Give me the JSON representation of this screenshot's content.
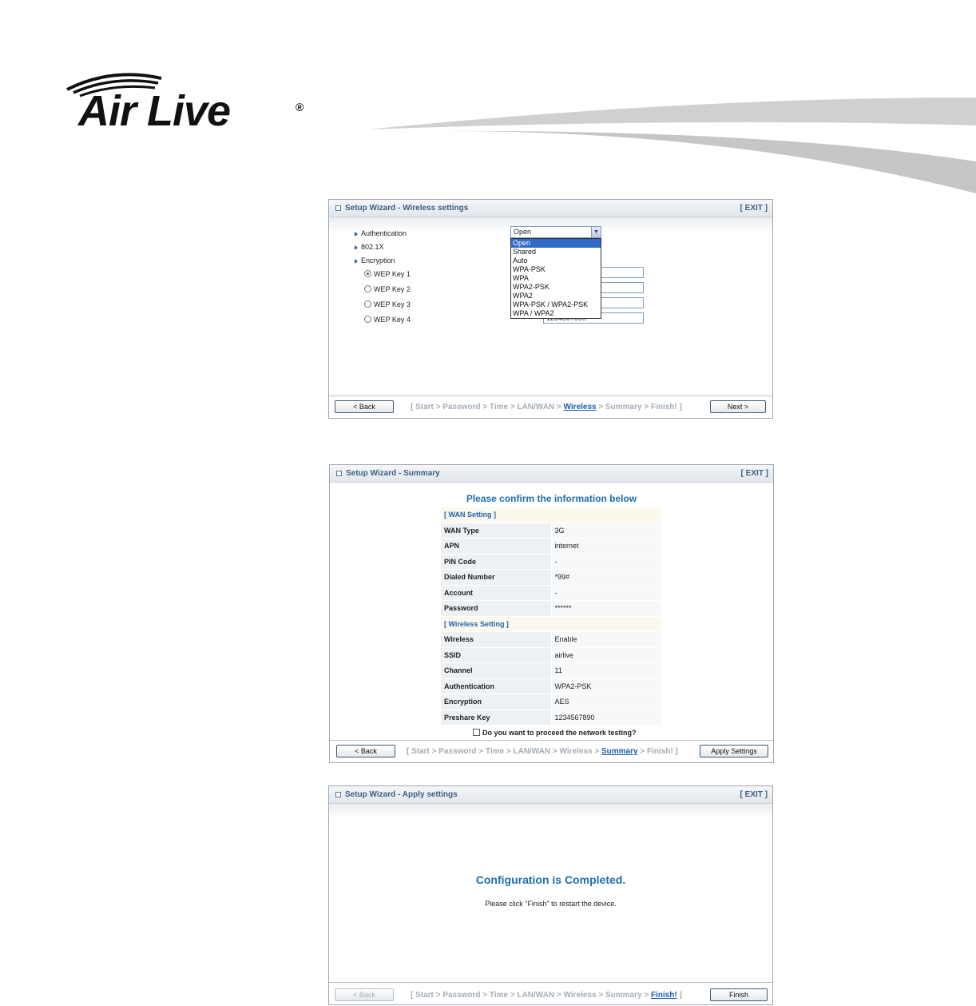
{
  "logo": {
    "text": "Air Live",
    "reg": "®"
  },
  "wireless_panel": {
    "title": "Setup Wizard - Wireless settings",
    "exit": "[ EXIT ]",
    "rows": {
      "authentication": "Authentication",
      "dot1x": "802.1X",
      "encryption": "Encryption",
      "wep1": "WEP Key 1",
      "wep2": "WEP Key 2",
      "wep3": "WEP Key 3",
      "wep4": "WEP Key 4"
    },
    "auth_selected": "Open",
    "auth_options": [
      "Open",
      "Shared",
      "Auto",
      "WPA-PSK",
      "WPA",
      "WPA2-PSK",
      "WPA2",
      "WPA-PSK / WPA2-PSK",
      "WPA / WPA2"
    ],
    "wep4_partial_value": "1234567890",
    "back": "< Back",
    "next": "Next >",
    "crumbs": {
      "pre": "[ Start > Password > Time > LAN/WAN > ",
      "cur": "Wireless",
      "post": " > Summary > Finish! ]"
    }
  },
  "summary_panel": {
    "title": "Setup Wizard - Summary",
    "exit": "[ EXIT ]",
    "heading": "Please confirm the information below",
    "wan_section": "[ WAN Setting ]",
    "wan_rows": [
      {
        "k": "WAN Type",
        "v": "3G"
      },
      {
        "k": "APN",
        "v": "internet"
      },
      {
        "k": "PIN Code",
        "v": "-"
      },
      {
        "k": "Dialed Number",
        "v": "*99#"
      },
      {
        "k": "Account",
        "v": "-"
      },
      {
        "k": "Password",
        "v": "******"
      }
    ],
    "wireless_section": "[ Wireless Setting ]",
    "wireless_rows": [
      {
        "k": "Wireless",
        "v": "Enable"
      },
      {
        "k": "SSID",
        "v": "airlive"
      },
      {
        "k": "Channel",
        "v": "11"
      },
      {
        "k": "Authentication",
        "v": "WPA2-PSK"
      },
      {
        "k": "Encryption",
        "v": "AES"
      },
      {
        "k": "Preshare Key",
        "v": "1234567890"
      }
    ],
    "test_label": "Do you want to proceed the network testing?",
    "back": "< Back",
    "apply": "Apply Settings",
    "crumbs": {
      "pre": "[ Start > Password > Time > LAN/WAN > Wireless > ",
      "cur": "Summary",
      "post": " > Finish! ]"
    }
  },
  "apply_panel": {
    "title": "Setup Wizard - Apply settings",
    "exit": "[ EXIT ]",
    "completed": "Configuration is Completed.",
    "restart": "Please click \"Finish\" to restart the device.",
    "back": "< Back",
    "finish": "Finish",
    "crumbs": {
      "pre": "[ Start > Password > Time > LAN/WAN > Wireless > Summary > ",
      "cur": "Finish!",
      "post": " ]"
    }
  }
}
